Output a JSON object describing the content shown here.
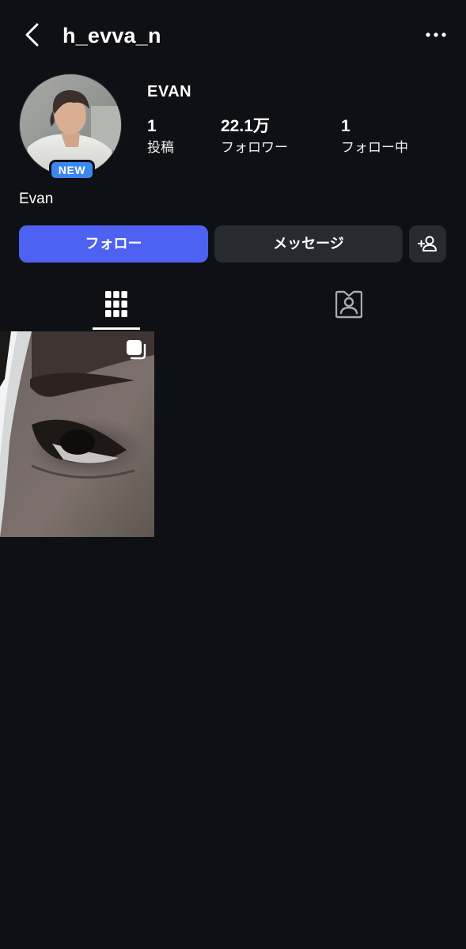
{
  "header": {
    "back_icon": "chevron-left-icon",
    "username": "h_evva_n",
    "more_icon": "more-horizontal-icon"
  },
  "profile": {
    "new_badge": "NEW",
    "display_name": "EVAN",
    "bio": "Evan",
    "stats": [
      {
        "value": "1",
        "label": "投稿"
      },
      {
        "value": "22.1万",
        "label": "フォロワー"
      },
      {
        "value": "1",
        "label": "フォロー中"
      }
    ]
  },
  "actions": {
    "follow": "フォロー",
    "message": "メッセージ",
    "add_friend_icon": "add-person-icon"
  },
  "tabs": [
    {
      "icon": "grid-icon",
      "active": true
    },
    {
      "icon": "tagged-person-icon",
      "active": false
    }
  ],
  "posts": [
    {
      "type": "multi-photo",
      "icon": "multiple-photos-icon"
    }
  ],
  "colors": {
    "background": "#0e1015",
    "follow_button": "#4d62f2",
    "secondary_button": "#272a31",
    "new_badge": "#3b86f0"
  }
}
